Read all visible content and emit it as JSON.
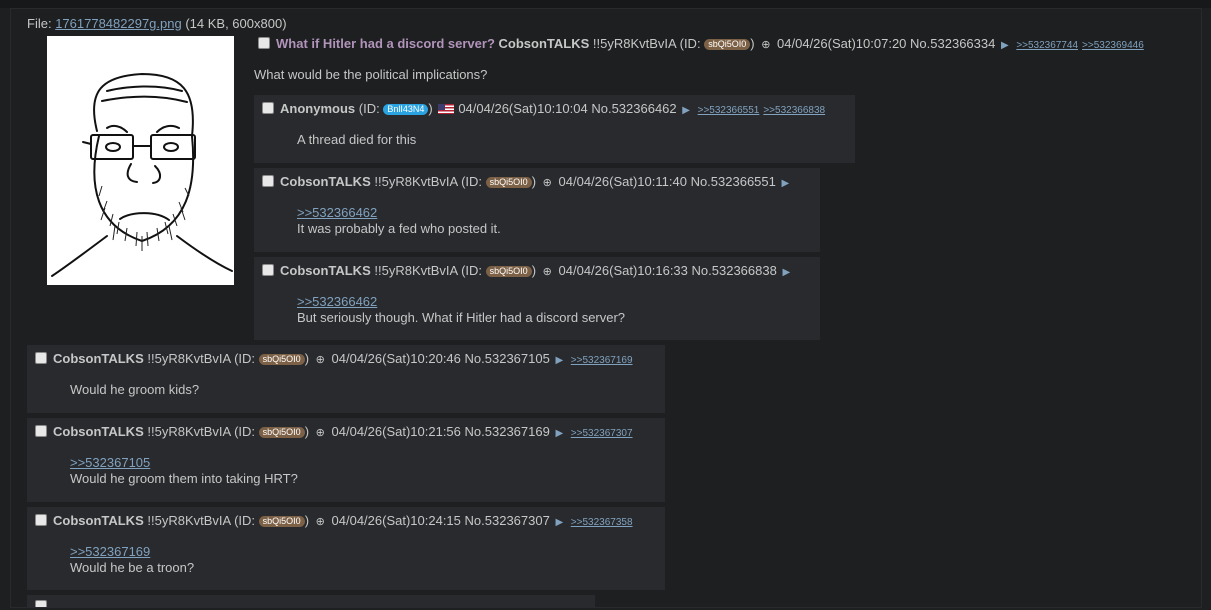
{
  "file": {
    "label": "File:",
    "name": "1761778482297g.png",
    "meta": "(14 KB, 600x800)"
  },
  "op": {
    "subject": "What if Hitler had a discord server?",
    "name": "CobsonTALKS",
    "trip": "!!5yR8KvtBvIA",
    "id_prefix": "(ID:",
    "id": "sbQi5OI0",
    "id_suffix": ")",
    "datetime": "04/04/26(Sat)10:07:20",
    "no": "No.532366334",
    "backlinks": [
      ">>532367744",
      ">>532369446"
    ],
    "text": "What would be the political implications?"
  },
  "replies": [
    {
      "name": "Anonymous",
      "trip": "",
      "id_prefix": "(ID:",
      "id": "BnlI43N4",
      "id_suffix": ")",
      "datetime": "04/04/26(Sat)10:10:04",
      "no": "No.532366462",
      "backlinks": [
        ">>532366551",
        ">>532366838"
      ],
      "quote": "",
      "text": "A thread died for this"
    },
    {
      "name": "CobsonTALKS",
      "trip": "!!5yR8KvtBvIA",
      "id_prefix": "(ID:",
      "id": "sbQi5OI0",
      "id_suffix": ")",
      "datetime": "04/04/26(Sat)10:11:40",
      "no": "No.532366551",
      "backlinks": [],
      "quote": ">>532366462",
      "text": "It was probably a fed who posted it."
    },
    {
      "name": "CobsonTALKS",
      "trip": "!!5yR8KvtBvIA",
      "id_prefix": "(ID:",
      "id": "sbQi5OI0",
      "id_suffix": ")",
      "datetime": "04/04/26(Sat)10:16:33",
      "no": "No.532366838",
      "backlinks": [],
      "quote": ">>532366462",
      "text": "But seriously though. What if Hitler had a discord server?"
    },
    {
      "name": "CobsonTALKS",
      "trip": "!!5yR8KvtBvIA",
      "id_prefix": "(ID:",
      "id": "sbQi5OI0",
      "id_suffix": ")",
      "datetime": "04/04/26(Sat)10:20:46",
      "no": "No.532367105",
      "backlinks": [
        ">>532367169"
      ],
      "quote": "",
      "text": "Would he groom kids?"
    },
    {
      "name": "CobsonTALKS",
      "trip": "!!5yR8KvtBvIA",
      "id_prefix": "(ID:",
      "id": "sbQi5OI0",
      "id_suffix": ")",
      "datetime": "04/04/26(Sat)10:21:56",
      "no": "No.532367169",
      "backlinks": [
        ">>532367307"
      ],
      "quote": ">>532367105",
      "text": "Would he groom them into taking HRT?"
    },
    {
      "name": "CobsonTALKS",
      "trip": "!!5yR8KvtBvIA",
      "id_prefix": "(ID:",
      "id": "sbQi5OI0",
      "id_suffix": ")",
      "datetime": "04/04/26(Sat)10:24:15",
      "no": "No.532367307",
      "backlinks": [
        ">>532367358"
      ],
      "quote": ">>532367169",
      "text": "Would he be a troon?"
    }
  ]
}
